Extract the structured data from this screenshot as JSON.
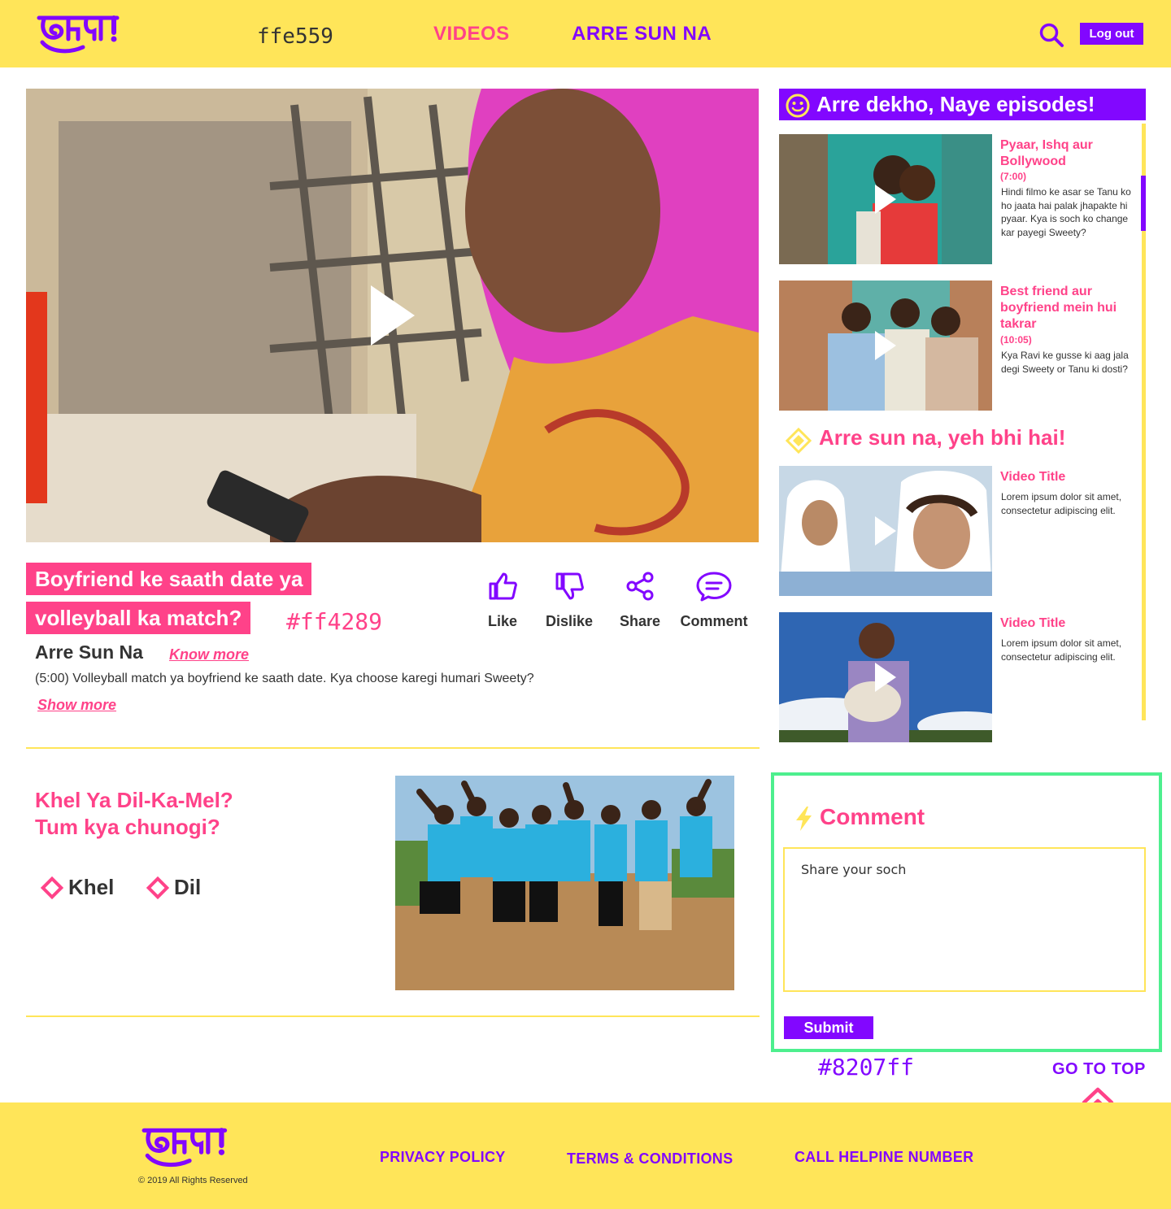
{
  "colors": {
    "yellow": "#ffe559",
    "pink": "#ff4289",
    "purple": "#8207ff",
    "green": "#4def8e"
  },
  "header": {
    "logo_text": "छाजा!",
    "hex_note": "ffe559",
    "nav": [
      {
        "label": "VIDEOS"
      },
      {
        "label": "ARRE SUN NA"
      }
    ],
    "search_icon": "search-icon",
    "logout_label": "Log out"
  },
  "main": {
    "title_line1": "Boyfriend ke saath date ya",
    "title_line2": "volleyball ka match?",
    "hex_note": "#ff4289",
    "actions": [
      {
        "label": "Like",
        "icon": "thumbs-up-icon"
      },
      {
        "label": "Dislike",
        "icon": "thumbs-down-icon"
      },
      {
        "label": "Share",
        "icon": "share-icon"
      },
      {
        "label": "Comment",
        "icon": "comment-icon"
      }
    ],
    "show_name": "Arre Sun Na",
    "know_more": "Know more",
    "description": "(5:00) Volleyball match ya boyfriend ke saath date. Kya choose karegi humari Sweety?",
    "show_more": "Show more"
  },
  "poll": {
    "question_line1": "Khel Ya Dil-Ka-Mel?",
    "question_line2": "Tum kya chunogi?",
    "options": [
      {
        "label": "Khel"
      },
      {
        "label": "Dil"
      }
    ]
  },
  "sidebar": {
    "heading": "Arre dekho, Naye episodes!",
    "episodes": [
      {
        "title": "Pyaar, Ishq aur Bollywood",
        "duration": "(7:00)",
        "description": "Hindi filmo ke asar se Tanu ko ho jaata hai palak jhapakte hi pyaar. Kya is soch ko change kar payegi Sweety?"
      },
      {
        "title": "Best friend aur boyfriend mein hui takrar",
        "duration": "(10:05)",
        "description": "Kya Ravi ke gusse ki aag jala degi Sweety or Tanu ki dosti?"
      }
    ],
    "subheading": "Arre sun na, yeh bhi hai!",
    "more_videos": [
      {
        "title": "Video Title",
        "description": "Lorem ipsum dolor sit amet, consectetur adipiscing elit."
      },
      {
        "title": "Video Title",
        "description": "Lorem ipsum dolor sit amet, consectetur adipiscing elit."
      }
    ]
  },
  "comment": {
    "title": "Comment",
    "placeholder": "Share your soch",
    "submit_label": "Submit",
    "hex_note": "#8207ff"
  },
  "go_to_top": "GO TO TOP",
  "footer": {
    "logo_text": "छाजा!",
    "copyright": "© 2019 All Rights Reserved",
    "links": [
      {
        "label": "PRIVACY POLICY"
      },
      {
        "label": "TERMS & CONDITIONS"
      },
      {
        "label": "CALL HELPINE NUMBER"
      }
    ]
  }
}
